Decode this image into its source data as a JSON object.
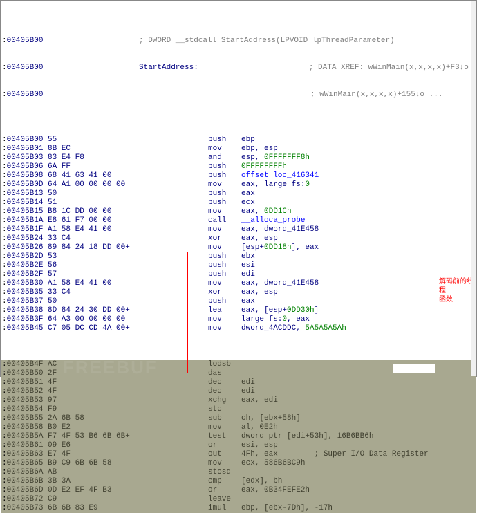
{
  "header": {
    "addr1": "00405B00",
    "comment1": "; DWORD __stdcall StartAddress(LPVOID lpThreadParameter)",
    "addr2": "00405B00",
    "func_name": "StartAddress:",
    "xref1": "; DATA XREF: wWinMain(x,x,x,x)+F3↓o",
    "addr3": "00405B00",
    "xref2": "; wWinMain(x,x,x,x)+155↓o ..."
  },
  "lines": [
    {
      "addr": "00405B00",
      "bytes": "55",
      "mnem": "push",
      "ops": "ebp"
    },
    {
      "addr": "00405B01",
      "bytes": "8B EC",
      "mnem": "mov",
      "ops": "ebp, esp"
    },
    {
      "addr": "00405B03",
      "bytes": "83 E4 F8",
      "mnem": "and",
      "ops": "esp, ",
      "green": "0FFFFFFF8h"
    },
    {
      "addr": "00405B06",
      "bytes": "6A FF",
      "mnem": "push",
      "ops": "",
      "green": "0FFFFFFFFh"
    },
    {
      "addr": "00405B08",
      "bytes": "68 41 63 41 00",
      "mnem": "push",
      "ops": "",
      "link": "offset loc_416341"
    },
    {
      "addr": "00405B0D",
      "bytes": "64 A1 00 00 00 00",
      "mnem": "mov",
      "ops": "eax, large fs:",
      "green": "0"
    },
    {
      "addr": "00405B13",
      "bytes": "50",
      "mnem": "push",
      "ops": "eax"
    },
    {
      "addr": "00405B14",
      "bytes": "51",
      "mnem": "push",
      "ops": "ecx"
    },
    {
      "addr": "00405B15",
      "bytes": "B8 1C DD 00 00",
      "mnem": "mov",
      "ops": "eax, ",
      "green": "0DD1Ch"
    },
    {
      "addr": "00405B1A",
      "bytes": "E8 61 F7 00 00",
      "mnem": "call",
      "ops": "",
      "link": "__alloca_probe"
    },
    {
      "addr": "00405B1F",
      "bytes": "A1 58 E4 41 00",
      "mnem": "mov",
      "ops": "eax, dword_41E458"
    },
    {
      "addr": "00405B24",
      "bytes": "33 C4",
      "mnem": "xor",
      "ops": "eax, esp"
    },
    {
      "addr": "00405B26",
      "bytes": "89 84 24 18 DD 00+",
      "mnem": "mov",
      "ops": "[esp+",
      "green": "0DD18h",
      "tail": "], eax"
    },
    {
      "addr": "00405B2D",
      "bytes": "53",
      "mnem": "push",
      "ops": "ebx"
    },
    {
      "addr": "00405B2E",
      "bytes": "56",
      "mnem": "push",
      "ops": "esi"
    },
    {
      "addr": "00405B2F",
      "bytes": "57",
      "mnem": "push",
      "ops": "edi"
    },
    {
      "addr": "00405B30",
      "bytes": "A1 58 E4 41 00",
      "mnem": "mov",
      "ops": "eax, dword_41E458"
    },
    {
      "addr": "00405B35",
      "bytes": "33 C4",
      "mnem": "xor",
      "ops": "eax, esp"
    },
    {
      "addr": "00405B37",
      "bytes": "50",
      "mnem": "push",
      "ops": "eax"
    },
    {
      "addr": "00405B38",
      "bytes": "8D 84 24 30 DD 00+",
      "mnem": "lea",
      "ops": "eax, [esp+",
      "green": "0DD30h",
      "tail": "]"
    },
    {
      "addr": "00405B3F",
      "bytes": "64 A3 00 00 00 00",
      "mnem": "mov",
      "ops": "large fs:",
      "green": "0",
      "tail": ", eax"
    },
    {
      "addr": "00405B45",
      "bytes": "C7 05 DC CD 4A 00+",
      "mnem": "mov",
      "ops": "dword_4ACDDC, ",
      "green": "5A5A5A5Ah"
    }
  ],
  "sel_lines": [
    {
      "addr": "00405B4F",
      "bytes": "AC",
      "mnem": "lodsb",
      "ops": ""
    },
    {
      "addr": "00405B50",
      "bytes": "2F",
      "mnem": "das",
      "ops": ""
    },
    {
      "addr": "00405B51",
      "bytes": "4F",
      "mnem": "dec",
      "ops": "edi"
    },
    {
      "addr": "00405B52",
      "bytes": "4F",
      "mnem": "dec",
      "ops": "edi"
    },
    {
      "addr": "00405B53",
      "bytes": "97",
      "mnem": "xchg",
      "ops": "eax, edi"
    },
    {
      "addr": "00405B54",
      "bytes": "F9",
      "mnem": "stc",
      "ops": ""
    },
    {
      "addr": "00405B55",
      "bytes": "2A 6B 58",
      "mnem": "sub",
      "ops": "ch, [ebx+58h]"
    },
    {
      "addr": "00405B58",
      "bytes": "B0 E2",
      "mnem": "mov",
      "ops": "al, 0E2h"
    },
    {
      "addr": "00405B5A",
      "bytes": "F7 4F 53 B6 6B 6B+",
      "mnem": "test",
      "ops": "dword ptr [edi+53h], 16B6BB6h"
    },
    {
      "addr": "00405B61",
      "bytes": "09 E6",
      "mnem": "or",
      "ops": "esi, esp"
    },
    {
      "addr": "00405B63",
      "bytes": "E7 4F",
      "mnem": "out",
      "ops": "4Fh, eax        ; Super I/O Data Register"
    },
    {
      "addr": "00405B65",
      "bytes": "B9 C9 6B 6B 58",
      "mnem": "mov",
      "ops": "ecx, 586B6BC9h"
    },
    {
      "addr": "00405B6A",
      "bytes": "AB",
      "mnem": "stosd",
      "ops": ""
    },
    {
      "addr": "00405B6B",
      "bytes": "3B 3A",
      "mnem": "cmp",
      "ops": "[edx], bh"
    },
    {
      "addr": "00405B6D",
      "bytes": "0D E2 EF 4F B3",
      "mnem": "or",
      "ops": "eax, 0B34FEFE2h"
    },
    {
      "addr": "00405B72",
      "bytes": "C9",
      "mnem": "leave",
      "ops": ""
    },
    {
      "addr": "00405B73",
      "bytes": "6B 6B 83 E9",
      "mnem": "imul",
      "ops": "ebp, [ebx-7Dh], -17h"
    }
  ],
  "annotation": {
    "line1": "解码前的线程",
    "line2": "函数"
  },
  "watermark": "FREEBUF"
}
